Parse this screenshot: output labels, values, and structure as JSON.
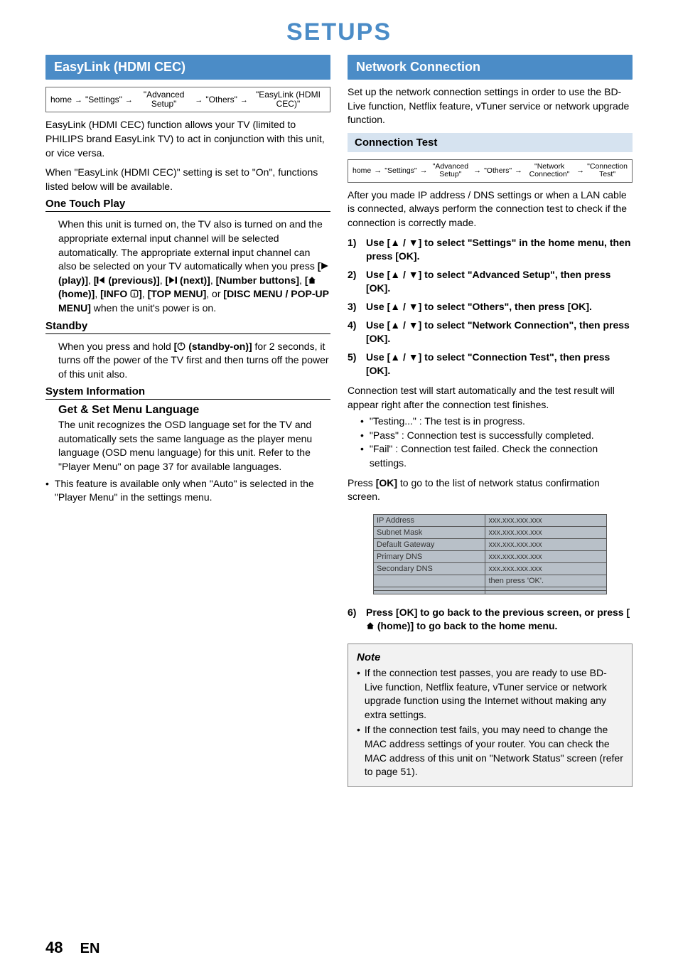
{
  "page": {
    "title": "SETUPS",
    "number": "48",
    "lang": "EN"
  },
  "left": {
    "header": "EasyLink (HDMI CEC)",
    "breadcrumb": [
      "home",
      "\"Settings\"",
      "\"Advanced Setup\"",
      "\"Others\"",
      "\"EasyLink (HDMI CEC)\""
    ],
    "intro": "EasyLink (HDMI CEC) function allows your TV (limited to PHILIPS brand EasyLink TV) to act in conjunction with this unit, or vice versa.",
    "when": "When \"EasyLink (HDMI CEC)\" setting is set to \"On\", functions listed below will be available.",
    "otp_h": "One Touch Play",
    "otp_body1": "When this unit is turned on, the TV also is turned on and the appropriate external input channel will be selected automatically. The appropriate external input channel can also be selected on your TV automatically when you press ",
    "otp_btn_play": "(play)]",
    "otp_btn_prev": "(previous)]",
    "otp_btn_next": "(next)]",
    "otp_btn_num": "[Number buttons]",
    "otp_btn_home": "(home)]",
    "otp_btn_info": "[INFO ",
    "otp_btn_info2": "]",
    "otp_btn_top": "[TOP MENU]",
    "otp_or": ", or ",
    "otp_btn_disc": "[DISC MENU / POP-UP MENU]",
    "otp_tail": " when the unit's power is on.",
    "standby_h": "Standby",
    "standby_body1": "When you press and hold ",
    "standby_btn": "(standby-on)]",
    "standby_body2": " for 2 seconds, it turns off the power of the TV first and then turns off the power of this unit also.",
    "sys_h": "System Information",
    "sys_sub": "Get & Set Menu Language",
    "sys_body": "The unit recognizes the OSD language set for the TV and automatically sets the same language as the player menu language (OSD menu language) for this unit. Refer to the \"Player Menu\" on page 37 for available languages.",
    "sys_bullet": "This feature is available only when \"Auto\" is selected in the \"Player Menu\" in the settings menu."
  },
  "right": {
    "header": "Network Connection",
    "intro": "Set up the network connection settings in order to use the BD-Live function, Netflix feature, vTuner service or network upgrade function.",
    "conn_h": "Connection Test",
    "breadcrumb": [
      "home",
      "\"Settings\"",
      "\"Advanced Setup\"",
      "\"Others\"",
      "\"Network Connection\"",
      "\"Connection Test\""
    ],
    "after": "After you made IP address / DNS settings or when a LAN cable is connected, always perform the connection test to check if the connection is correctly made.",
    "steps": [
      "Use [▲ / ▼] to select \"Settings\" in the home menu, then press [OK].",
      "Use [▲ / ▼] to select \"Advanced Setup\", then press [OK].",
      "Use [▲ / ▼] to select \"Others\", then press [OK].",
      "Use [▲ / ▼] to select \"Network Connection\", then press [OK].",
      "Use [▲ / ▼] to select \"Connection Test\", then press [OK]."
    ],
    "test_body": "Connection test will start automatically and the test result will appear right after the connection test finishes.",
    "bullets": [
      "\"Testing...\" : The test is in progress.",
      "\"Pass\" : Connection test is successfully completed.",
      "\"Fail\" : Connection test failed. Check the connection settings."
    ],
    "press_ok": "Press [OK] to go to the list of network status confirmation screen.",
    "table": [
      [
        "IP Address",
        "xxx.xxx.xxx.xxx"
      ],
      [
        "Subnet Mask",
        "xxx.xxx.xxx.xxx"
      ],
      [
        "Default Gateway",
        "xxx.xxx.xxx.xxx"
      ],
      [
        "Primary DNS",
        "xxx.xxx.xxx.xxx"
      ],
      [
        "Secondary DNS",
        "xxx.xxx.xxx.xxx"
      ],
      [
        "",
        "then press 'OK'."
      ],
      [
        "",
        ""
      ],
      [
        "",
        ""
      ]
    ],
    "step6a": "Press [OK] to go back to the previous screen, or press [",
    "step6b": " (home)] to go back to the home menu.",
    "note_title": "Note",
    "notes": [
      "If the connection test passes, you are ready to use BD-Live function, Netflix feature, vTuner service or network upgrade function using the Internet without making any extra settings.",
      "If the connection test fails, you may need to change the MAC address settings of your router. You can check the MAC address of this unit on \"Network Status\" screen (refer to page 51)."
    ]
  }
}
